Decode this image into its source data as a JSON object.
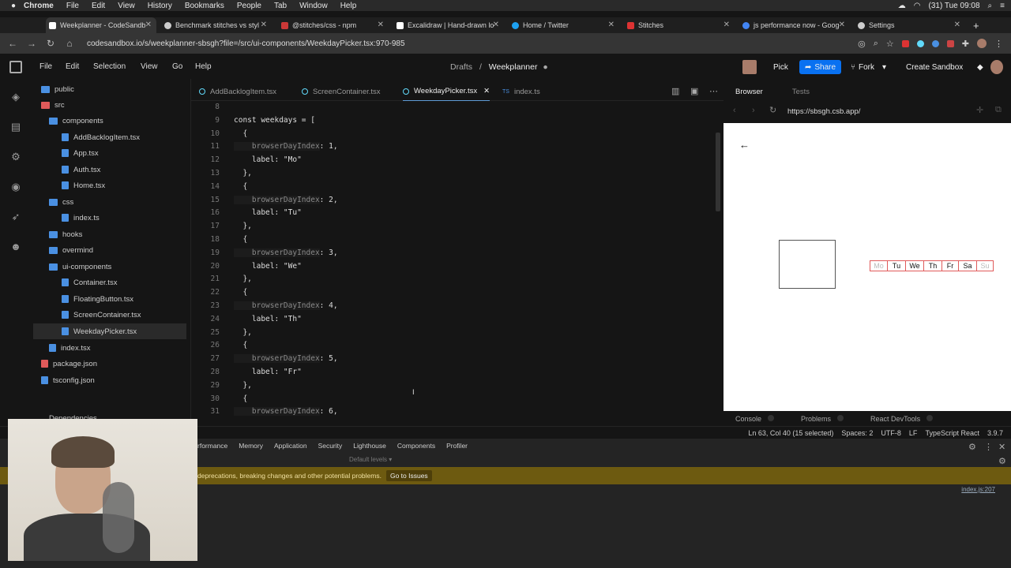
{
  "macos_menubar": {
    "app": "Chrome",
    "items": [
      "File",
      "Edit",
      "View",
      "History",
      "Bookmarks",
      "People",
      "Tab",
      "Window",
      "Help"
    ],
    "clock": "(31) Tue 09:08"
  },
  "browser_tabs": [
    {
      "title": "Weekplanner - CodeSandb",
      "active": true,
      "fav_color": "#ffffff"
    },
    {
      "title": "Benchmark stitches vs styl",
      "active": false,
      "fav_color": "#cccccc"
    },
    {
      "title": "@stitches/css - npm",
      "active": false,
      "fav_color": "#cb3837"
    },
    {
      "title": "Excalidraw | Hand-drawn lo",
      "active": false,
      "fav_color": "#ffffff"
    },
    {
      "title": "Home / Twitter",
      "active": false,
      "fav_color": "#1da1f2"
    },
    {
      "title": "Stitches",
      "active": false,
      "fav_color": "#d33"
    },
    {
      "title": "js performance now - Goog",
      "active": false,
      "fav_color": "#4285f4"
    },
    {
      "title": "Settings",
      "active": false,
      "fav_color": "#ccc"
    }
  ],
  "address": {
    "url": "codesandbox.io/s/weekplanner-sbsgh?file=/src/ui-components/WeekdayPicker.tsx:970-985"
  },
  "csb_menu": [
    "File",
    "Edit",
    "Selection",
    "View",
    "Go",
    "Help"
  ],
  "breadcrumb": {
    "folder": "Drafts",
    "separator": "/",
    "project": "Weekplanner"
  },
  "header_buttons": {
    "pick": "Pick",
    "share": "Share",
    "fork": "Fork",
    "create": "Create Sandbox"
  },
  "file_tree": [
    {
      "name": "public",
      "type": "folder",
      "depth": 0
    },
    {
      "name": "src",
      "type": "folder",
      "depth": 0,
      "color": "#e05a5a"
    },
    {
      "name": "components",
      "type": "folder",
      "depth": 1
    },
    {
      "name": "AddBacklogItem.tsx",
      "type": "file",
      "depth": 2
    },
    {
      "name": "App.tsx",
      "type": "file",
      "depth": 2
    },
    {
      "name": "Auth.tsx",
      "type": "file",
      "depth": 2
    },
    {
      "name": "Home.tsx",
      "type": "file",
      "depth": 2
    },
    {
      "name": "css",
      "type": "folder",
      "depth": 1
    },
    {
      "name": "index.ts",
      "type": "file",
      "depth": 2
    },
    {
      "name": "hooks",
      "type": "folder",
      "depth": 1
    },
    {
      "name": "overmind",
      "type": "folder",
      "depth": 1
    },
    {
      "name": "ui-components",
      "type": "folder",
      "depth": 1
    },
    {
      "name": "Container.tsx",
      "type": "file",
      "depth": 2
    },
    {
      "name": "FloatingButton.tsx",
      "type": "file",
      "depth": 2
    },
    {
      "name": "ScreenContainer.tsx",
      "type": "file",
      "depth": 2
    },
    {
      "name": "WeekdayPicker.tsx",
      "type": "file",
      "depth": 2,
      "selected": true
    },
    {
      "name": "index.tsx",
      "type": "file",
      "depth": 1
    },
    {
      "name": "package.json",
      "type": "file",
      "depth": 0,
      "color": "#e05a5a"
    },
    {
      "name": "tsconfig.json",
      "type": "file",
      "depth": 0
    }
  ],
  "dependencies_label": "Dependencies",
  "editor_tabs": [
    {
      "name": "AddBacklogItem.tsx",
      "active": false
    },
    {
      "name": "ScreenContainer.tsx",
      "active": false
    },
    {
      "name": "WeekdayPicker.tsx",
      "active": true
    },
    {
      "name": "index.ts",
      "active": false
    }
  ],
  "code_lines": [
    {
      "n": "8",
      "code": ""
    },
    {
      "n": "9",
      "code": "const weekdays = ["
    },
    {
      "n": "10",
      "code": "  {"
    },
    {
      "n": "11",
      "prop": "    browserDayIndex",
      "rest": ": 1,"
    },
    {
      "n": "12",
      "code": "    label: \"Mo\""
    },
    {
      "n": "13",
      "code": "  },"
    },
    {
      "n": "14",
      "code": "  {"
    },
    {
      "n": "15",
      "prop": "    browserDayIndex",
      "rest": ": 2,"
    },
    {
      "n": "16",
      "code": "    label: \"Tu\""
    },
    {
      "n": "17",
      "code": "  },"
    },
    {
      "n": "18",
      "code": "  {"
    },
    {
      "n": "19",
      "prop": "    browserDayIndex",
      "rest": ": 3,"
    },
    {
      "n": "20",
      "code": "    label: \"We\""
    },
    {
      "n": "21",
      "code": "  },"
    },
    {
      "n": "22",
      "code": "  {"
    },
    {
      "n": "23",
      "prop": "    browserDayIndex",
      "rest": ": 4,"
    },
    {
      "n": "24",
      "code": "    label: \"Th\""
    },
    {
      "n": "25",
      "code": "  },"
    },
    {
      "n": "26",
      "code": "  {"
    },
    {
      "n": "27",
      "prop": "    browserDayIndex",
      "rest": ": 5,"
    },
    {
      "n": "28",
      "code": "    label: \"Fr\""
    },
    {
      "n": "29",
      "code": "  },"
    },
    {
      "n": "30",
      "code": "  {"
    },
    {
      "n": "31",
      "prop": "    browserDayIndex",
      "rest": ": 6,"
    }
  ],
  "preview": {
    "tab_browser": "Browser",
    "tab_tests": "Tests",
    "url": "https://sbsgh.csb.app/",
    "days": [
      {
        "label": "Mo",
        "dim": true
      },
      {
        "label": "Tu",
        "dim": false
      },
      {
        "label": "We",
        "dim": false
      },
      {
        "label": "Th",
        "dim": false
      },
      {
        "label": "Fr",
        "dim": false
      },
      {
        "label": "Sa",
        "dim": false
      },
      {
        "label": "Su",
        "dim": true
      }
    ],
    "bottom_tabs": [
      "Console",
      "Problems",
      "React DevTools"
    ]
  },
  "status": {
    "cursor": "Ln 63, Col 40 (15 selected)",
    "spaces": "Spaces: 2",
    "encoding": "UTF-8",
    "eol": "LF",
    "lang": "TypeScript React",
    "version": "3.9.7"
  },
  "devtools": {
    "tabs": [
      "rformance",
      "Memory",
      "Application",
      "Security",
      "Lighthouse",
      "Components",
      "Profiler"
    ],
    "levels": "Default levels ▾",
    "warning": "deprecations, breaking changes and other potential problems.",
    "goto": "Go to Issues",
    "source": "index.js:207"
  },
  "colors": {
    "accent": "#0971f1",
    "warn_bg": "#6d5a10",
    "day_border": "#e05a5a"
  }
}
